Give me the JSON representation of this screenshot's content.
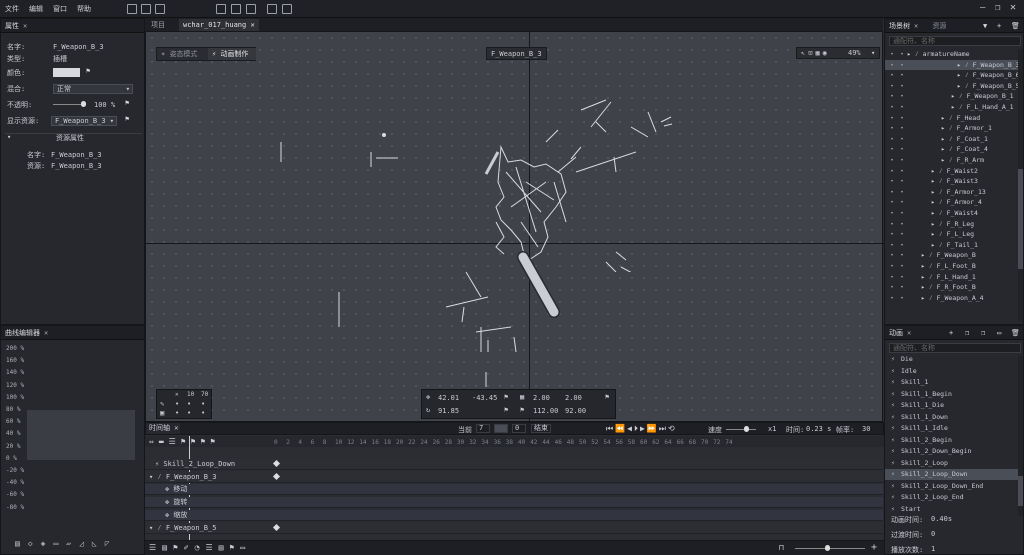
{
  "menu": [
    "文件",
    "编辑",
    "窗口",
    "帮助"
  ],
  "viewport_tabs": [
    {
      "label": "项目",
      "active": false
    },
    {
      "label": "wchar_017_huang",
      "active": true
    }
  ],
  "properties": {
    "title": "属性",
    "rows": [
      {
        "label": "名字:",
        "value": "F_Weapon_B_3"
      },
      {
        "label": "类型:",
        "value": "插槽"
      },
      {
        "label": "颜色:",
        "value": ""
      },
      {
        "label": "混合:",
        "value": "正常"
      },
      {
        "label": "不透明:",
        "value": "100"
      },
      {
        "label": "显示资源:",
        "value": "F_Weapon_B_3"
      }
    ],
    "percent_sign": "%",
    "resource_title": "资源属性",
    "resource_rows": [
      {
        "label": "名字:",
        "value": "F_Weapon_B_3"
      },
      {
        "label": "资源:",
        "value": "F_Weapon_B_3"
      }
    ]
  },
  "curve_editor": {
    "title": "曲线编辑器",
    "y_labels": [
      "200 %",
      "160 %",
      "140 %",
      "120 %",
      "100 %",
      "80 %",
      "60 %",
      "40 %",
      "20 %",
      "0 %",
      "-20 %",
      "-40 %",
      "-60 %",
      "-80 %"
    ]
  },
  "viewport": {
    "mode_left": "姿态模式",
    "mode_right": "动画制作",
    "selected_label": "F_Weapon_B_3",
    "zoom": "49%",
    "transform": {
      "x": "42.01",
      "y": "-43.45",
      "rotation": "91.85",
      "scale_x": "2.00",
      "scale_y": "2.00",
      "width": "112.00",
      "height": "92.00"
    },
    "tool_numbers": [
      "10",
      "70"
    ]
  },
  "scene_tree": {
    "title": "场景树",
    "tab2": "资源",
    "search_placeholder": "通配符、名称",
    "items": [
      {
        "name": "armatureName",
        "indent": 22
      },
      {
        "name": "F_Weapon_B_3",
        "indent": 72,
        "sel": true
      },
      {
        "name": "F_Weapon_B_6",
        "indent": 72
      },
      {
        "name": "F_Weapon_B_5",
        "indent": 72
      },
      {
        "name": "F_Weapon_B_1",
        "indent": 66
      },
      {
        "name": "F_L_Hand_A_1",
        "indent": 66
      },
      {
        "name": "F_Head",
        "indent": 56
      },
      {
        "name": "F_Armor_1",
        "indent": 56
      },
      {
        "name": "F_Coat_1",
        "indent": 56
      },
      {
        "name": "F_Coat_4",
        "indent": 56
      },
      {
        "name": "F_R_Arm",
        "indent": 56
      },
      {
        "name": "F_Waist2",
        "indent": 46
      },
      {
        "name": "F_Waist3",
        "indent": 46
      },
      {
        "name": "F_Armor_13",
        "indent": 46
      },
      {
        "name": "F_Armor_4",
        "indent": 46
      },
      {
        "name": "F_Waist4",
        "indent": 46
      },
      {
        "name": "F_R_Leg",
        "indent": 46
      },
      {
        "name": "F_L_Leg",
        "indent": 46
      },
      {
        "name": "F_Tail_1",
        "indent": 46
      },
      {
        "name": "F_Weapon_B",
        "indent": 36
      },
      {
        "name": "F_L_Foot_B",
        "indent": 36
      },
      {
        "name": "F_L_Hand_1",
        "indent": 36
      },
      {
        "name": "F_R_Foot_B",
        "indent": 36
      },
      {
        "name": "F_Weapon_A_4",
        "indent": 36
      }
    ]
  },
  "animations": {
    "title": "动画",
    "search_placeholder": "通配符、名称",
    "items": [
      "Die",
      "Idle",
      "Skill_1",
      "Skill_1_Begin",
      "Skill_1_Die",
      "Skill_1_Down",
      "Skill_1_Idle",
      "Skill_2_Begin",
      "Skill_2_Down_Begin",
      "Skill_2_Loop",
      "Skill_2_Loop_Down",
      "Skill_2_Loop_Down_End",
      "Skill_2_Loop_End",
      "Start"
    ],
    "selected": "Skill_2_Loop_Down",
    "duration_label": "动画时间:",
    "duration_value": "0.40s",
    "transition_label": "过渡时间:",
    "transition_value": "0",
    "play_label": "播放次数:",
    "play_value": "1"
  },
  "timeline": {
    "title": "时间轴",
    "current_label": "当前",
    "current_value": "7",
    "total_value": "0",
    "loop_label": "结束",
    "speed_label": "速度",
    "speed_value": "x1",
    "time_label": "时间:",
    "time_value": "0.23 s",
    "fps_label": "帧率:",
    "fps_value": "30",
    "ticks": [
      "0",
      "2",
      "4",
      "6",
      "8",
      "10",
      "12",
      "14",
      "16",
      "18",
      "20",
      "22",
      "24",
      "26",
      "28",
      "30",
      "32",
      "34",
      "36",
      "38",
      "40",
      "42",
      "44",
      "46",
      "48",
      "50",
      "52",
      "54",
      "56",
      "58",
      "60",
      "62",
      "64",
      "66",
      "68",
      "70",
      "72",
      "74"
    ],
    "rows": [
      {
        "name": "Skill_2_Loop_Down",
        "type": "anim"
      },
      {
        "name": "F_Weapon_B_3",
        "type": "slot"
      },
      {
        "name": "移动",
        "type": "sub"
      },
      {
        "name": "旋转",
        "type": "sub"
      },
      {
        "name": "缩放",
        "type": "sub"
      },
      {
        "name": "F_Weapon_B_5",
        "type": "slot"
      }
    ]
  }
}
